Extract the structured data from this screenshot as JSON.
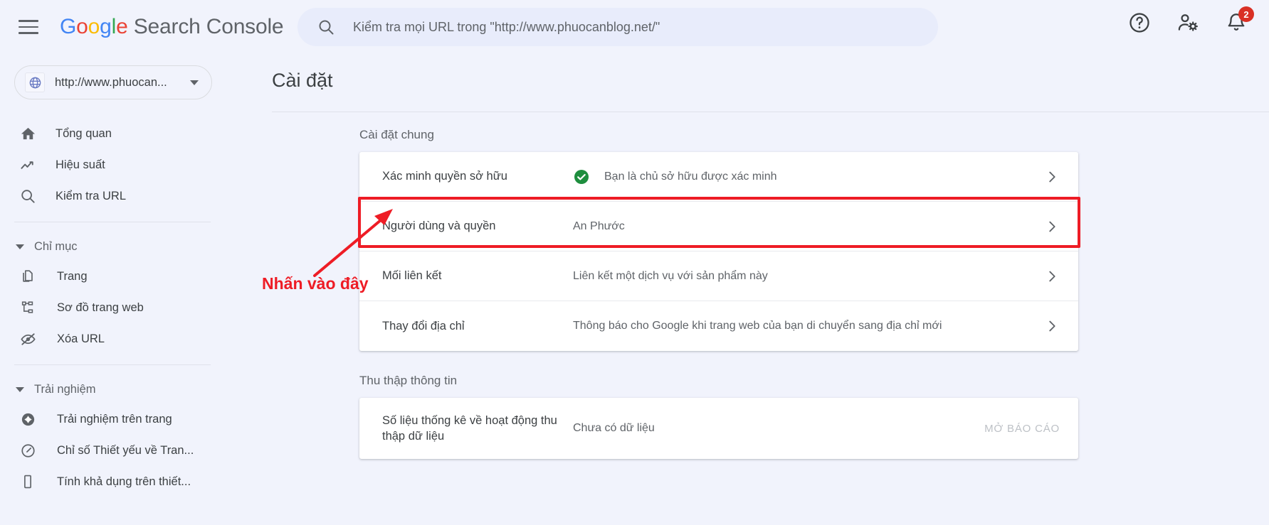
{
  "topbar": {
    "menu_icon": "hamburger-menu-icon",
    "brand": {
      "g": "G",
      "o1": "o",
      "o2": "o",
      "g2": "g",
      "l": "l",
      "e": "e",
      "product": "Search Console"
    },
    "search": {
      "icon": "search-icon",
      "placeholder": "Kiểm tra mọi URL trong \"http://www.phuocanblog.net/\"",
      "value": ""
    },
    "actions": [
      {
        "name": "help-icon",
        "label": "?"
      },
      {
        "name": "account-settings-icon",
        "label": ""
      },
      {
        "name": "notifications-bell-icon",
        "label": "",
        "badge": "2"
      }
    ]
  },
  "sidebar": {
    "property": {
      "icon": "globe-icon",
      "url": "http://www.phuocan...",
      "caret": "chevron-down-icon"
    },
    "items": [
      {
        "label": "Tổng quan",
        "icon": "home-icon"
      },
      {
        "label": "Hiệu suất",
        "icon": "trending-up-icon"
      },
      {
        "label": "Kiểm tra URL",
        "icon": "search-icon"
      }
    ],
    "groups": [
      {
        "label": "Chỉ mục",
        "caret": "chevron-down-icon",
        "items": [
          {
            "label": "Trang",
            "icon": "pages-icon"
          },
          {
            "label": "Sơ đồ trang web",
            "icon": "sitemap-icon"
          },
          {
            "label": "Xóa URL",
            "icon": "eye-off-icon"
          }
        ]
      },
      {
        "label": "Trải nghiệm",
        "caret": "chevron-down-icon",
        "items": [
          {
            "label": "Trải nghiệm trên trang",
            "icon": "page-experience-icon"
          },
          {
            "label": "Chỉ số Thiết yếu về Tran...",
            "icon": "speedometer-icon"
          },
          {
            "label": "Tính khả dụng trên thiết...",
            "icon": "mobile-icon"
          }
        ]
      }
    ]
  },
  "main": {
    "page_title": "Cài đặt",
    "sections": [
      {
        "label": "Cài đặt chung",
        "rows": [
          {
            "label": "Xác minh quyền sở hữu",
            "value": "Bạn là chủ sở hữu được xác minh",
            "status_icon": "green-check-circle-icon",
            "chevron": "chevron-right-icon"
          },
          {
            "label": "Người dùng và quyền",
            "value": "An Phước",
            "chevron": "chevron-right-icon",
            "highlighted": true
          },
          {
            "label": "Mối liên kết",
            "value": "Liên kết một dịch vụ với sản phẩm này",
            "chevron": "chevron-right-icon"
          },
          {
            "label": "Thay đổi địa chỉ",
            "value": "Thông báo cho Google khi trang web của bạn di chuyển sang địa chỉ mới",
            "chevron": "chevron-right-icon"
          }
        ]
      },
      {
        "label": "Thu thập thông tin",
        "rows": [
          {
            "label": "Số liệu thống kê về hoạt động thu thập dữ liệu",
            "value": "Chưa có dữ liệu",
            "action": "MỞ BÁO CÁO"
          }
        ]
      }
    ]
  },
  "annotation": {
    "text": "Nhấn vào đây",
    "color": "#ee1c25",
    "arrow": "red-arrow-pointing-up-right"
  }
}
